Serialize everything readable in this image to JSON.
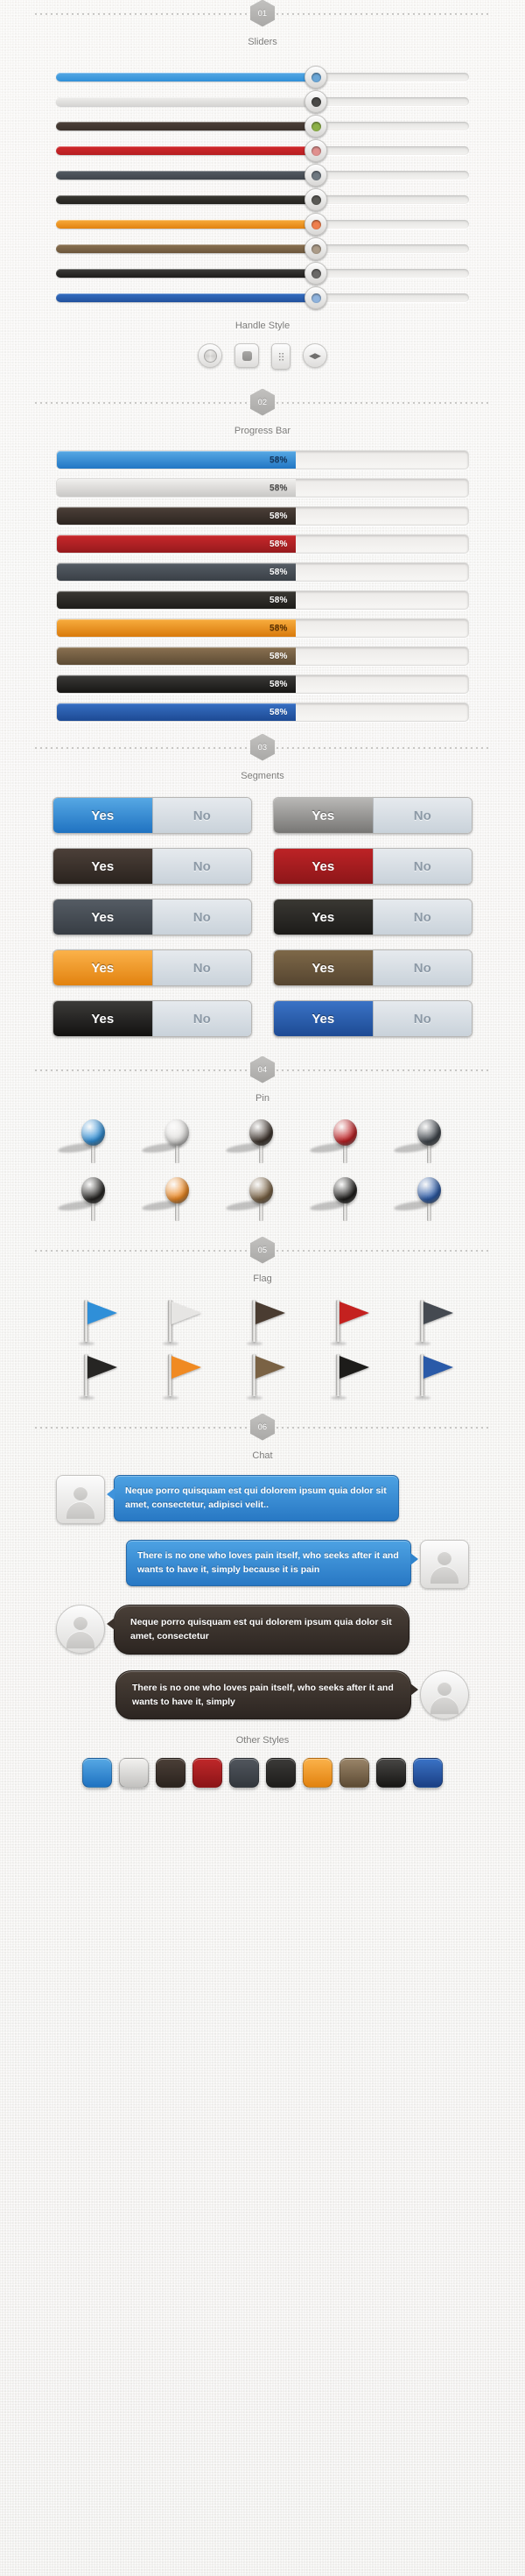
{
  "page": {
    "background": "#f2f1ef"
  },
  "sections": [
    {
      "number": "01",
      "title": "Sliders"
    },
    {
      "number": "02",
      "title": "Progress Bar"
    },
    {
      "number": "03",
      "title": "Segments"
    },
    {
      "number": "04",
      "title": "Pin"
    },
    {
      "number": "05",
      "title": "Flag"
    },
    {
      "number": "06",
      "title": "Chat"
    }
  ],
  "sliders": {
    "title": "Sliders",
    "value_percent": 63,
    "items": [
      {
        "name": "blue",
        "fill": "#2f8fd8",
        "fill_top": "#56a8e4",
        "knob": "#6ba6d6"
      },
      {
        "name": "silver",
        "fill": "#d6d5d3",
        "fill_top": "#eeedeb",
        "knob": "#4b4a48"
      },
      {
        "name": "dark-brown",
        "fill": "#3a302a",
        "fill_top": "#4c4039",
        "knob": "#8cb048"
      },
      {
        "name": "red",
        "fill": "#b61f22",
        "fill_top": "#d1292c",
        "knob": "#e0908e"
      },
      {
        "name": "slate",
        "fill": "#3e444b",
        "fill_top": "#545b63",
        "knob": "#6e7880"
      },
      {
        "name": "black-leather",
        "fill": "#24231f",
        "fill_top": "#3a3833",
        "knob": "#5a5955"
      },
      {
        "name": "orange-wood",
        "fill": "#e2820f",
        "fill_top": "#f7ab3c",
        "knob": "#ef7f4e"
      },
      {
        "name": "brown-leather",
        "fill": "#6b563c",
        "fill_top": "#8a7151",
        "knob": "#ab9b88"
      },
      {
        "name": "black",
        "fill": "#1d1c1a",
        "fill_top": "#3b3a38",
        "knob": "#6a6967"
      },
      {
        "name": "denim",
        "fill": "#22519c",
        "fill_top": "#356ec2",
        "knob": "#8fb3dd"
      }
    ],
    "handle_style": {
      "title": "Handle Style",
      "items": [
        {
          "name": "round-brushed-handle",
          "icon": "circle-brushed-icon"
        },
        {
          "name": "rounded-square-handle",
          "icon": "square-inset-icon"
        },
        {
          "name": "vertical-grip-handle",
          "icon": "dot-grid-icon"
        },
        {
          "name": "arrows-handle",
          "icon": "left-right-arrows-icon"
        }
      ]
    }
  },
  "progress": {
    "title": "Progress Bar",
    "value_label": "58%",
    "value_percent": 58,
    "items": [
      {
        "name": "blue",
        "fill_top": "#56a8e4",
        "fill_bottom": "#2176c4",
        "text": "#13355c"
      },
      {
        "name": "silver",
        "fill_top": "#f0efed",
        "fill_bottom": "#c9c8c6",
        "text": "#4a4948"
      },
      {
        "name": "dark-brown",
        "fill_top": "#4c4039",
        "fill_bottom": "#2d2520",
        "text": "#ffffff"
      },
      {
        "name": "red",
        "fill_top": "#c9282b",
        "fill_bottom": "#961a1d",
        "text": "#ffffff"
      },
      {
        "name": "slate",
        "fill_top": "#565d65",
        "fill_bottom": "#3a4047",
        "text": "#ffffff"
      },
      {
        "name": "black-leather",
        "fill_top": "#3a3833",
        "fill_bottom": "#1e1d1a",
        "text": "#ffffff"
      },
      {
        "name": "orange-wood",
        "fill_top": "#f8ad3e",
        "fill_bottom": "#d97a0c",
        "text": "#5a3000"
      },
      {
        "name": "brown-leather",
        "fill_top": "#8a7151",
        "fill_bottom": "#5d4b34",
        "text": "#ffffff"
      },
      {
        "name": "black",
        "fill_top": "#3b3a38",
        "fill_bottom": "#171614",
        "text": "#ffffff"
      },
      {
        "name": "denim",
        "fill_top": "#376fc3",
        "fill_bottom": "#1d4a94",
        "text": "#ffffff"
      }
    ]
  },
  "segments": {
    "title": "Segments",
    "yes_label": "Yes",
    "no_label": "No",
    "items": [
      {
        "name": "blue",
        "top": "#56a8e4",
        "bottom": "#1f72c1"
      },
      {
        "name": "silver",
        "top": "#b9b8b6",
        "bottom": "#777674"
      },
      {
        "name": "dark-brown",
        "top": "#4c4039",
        "bottom": "#2a231e"
      },
      {
        "name": "red",
        "top": "#bd2326",
        "bottom": "#8d1619"
      },
      {
        "name": "slate",
        "top": "#555c64",
        "bottom": "#373d44"
      },
      {
        "name": "black-leather",
        "top": "#3a3833",
        "bottom": "#1c1b19"
      },
      {
        "name": "orange-wood",
        "top": "#fbb24a",
        "bottom": "#e2820f"
      },
      {
        "name": "brown-leather",
        "top": "#7e6848",
        "bottom": "#564530"
      },
      {
        "name": "black",
        "top": "#3c3b39",
        "bottom": "#121110"
      },
      {
        "name": "denim",
        "top": "#3a73c6",
        "bottom": "#1d4a94"
      }
    ]
  },
  "pins": {
    "title": "Pin",
    "items": [
      {
        "name": "blue",
        "color": "#2f8fd8"
      },
      {
        "name": "white",
        "color": "#e3e2e0"
      },
      {
        "name": "dark-brown",
        "color": "#3d332c"
      },
      {
        "name": "red",
        "color": "#c01f22"
      },
      {
        "name": "slate",
        "color": "#3f454c"
      },
      {
        "name": "black-leather",
        "color": "#232220"
      },
      {
        "name": "orange",
        "color": "#f08a22"
      },
      {
        "name": "brown",
        "color": "#7a6244"
      },
      {
        "name": "black",
        "color": "#1b1a18"
      },
      {
        "name": "denim",
        "color": "#2a5aa8"
      }
    ]
  },
  "flags": {
    "title": "Flag",
    "items": [
      {
        "name": "blue",
        "color": "#2f8fd8"
      },
      {
        "name": "white",
        "color": "#e6e5e3"
      },
      {
        "name": "dark-brown",
        "color": "#4a3c31"
      },
      {
        "name": "red",
        "color": "#c4211f"
      },
      {
        "name": "slate",
        "color": "#454a51"
      },
      {
        "name": "black-leather",
        "color": "#262523"
      },
      {
        "name": "orange",
        "color": "#f08a22"
      },
      {
        "name": "brown",
        "color": "#7a6244"
      },
      {
        "name": "black",
        "color": "#1d1c1a"
      },
      {
        "name": "denim",
        "color": "#2a5aa8"
      }
    ]
  },
  "chat": {
    "title": "Chat",
    "messages": [
      {
        "name": "chat-message-blue-left",
        "side": "left",
        "style": "blue",
        "avatar_shape": "square",
        "text": "Neque porro quisquam est qui dolorem ipsum quia dolor sit amet, consectetur, adipisci velit.."
      },
      {
        "name": "chat-message-blue-right",
        "side": "right",
        "style": "blue",
        "avatar_shape": "square",
        "text": "There is no one who loves pain itself, who seeks after it and wants to have it, simply because it is pain"
      },
      {
        "name": "chat-message-dark-left",
        "side": "left",
        "style": "dark",
        "avatar_shape": "circle",
        "text": "Neque porro quisquam est qui dolorem ipsum quia dolor sit amet, consectetur"
      },
      {
        "name": "chat-message-dark-right",
        "side": "right",
        "style": "dark",
        "avatar_shape": "circle",
        "text": "There is no one who loves pain itself, who seeks after it and wants to have it, simply"
      }
    ]
  },
  "other_styles": {
    "title": "Other Styles",
    "swatches": [
      {
        "name": "blue",
        "top": "#56a8e4",
        "bottom": "#1f72c1"
      },
      {
        "name": "silver",
        "top": "#f2f1ef",
        "bottom": "#c3c2c0"
      },
      {
        "name": "dark-brown",
        "top": "#4b3f37",
        "bottom": "#2a231e"
      },
      {
        "name": "red",
        "top": "#c0282a",
        "bottom": "#8c1417"
      },
      {
        "name": "slate",
        "top": "#51565d",
        "bottom": "#33383e"
      },
      {
        "name": "black-leather",
        "top": "#3b3a38",
        "bottom": "#1d1c1a"
      },
      {
        "name": "orange-wood",
        "top": "#fbb24a",
        "bottom": "#e2820f"
      },
      {
        "name": "brown-leather",
        "top": "#9a8569",
        "bottom": "#5d4b34"
      },
      {
        "name": "black",
        "top": "#484745",
        "bottom": "#171614"
      },
      {
        "name": "denim",
        "top": "#3a73c6",
        "bottom": "#1b3f84"
      }
    ]
  }
}
